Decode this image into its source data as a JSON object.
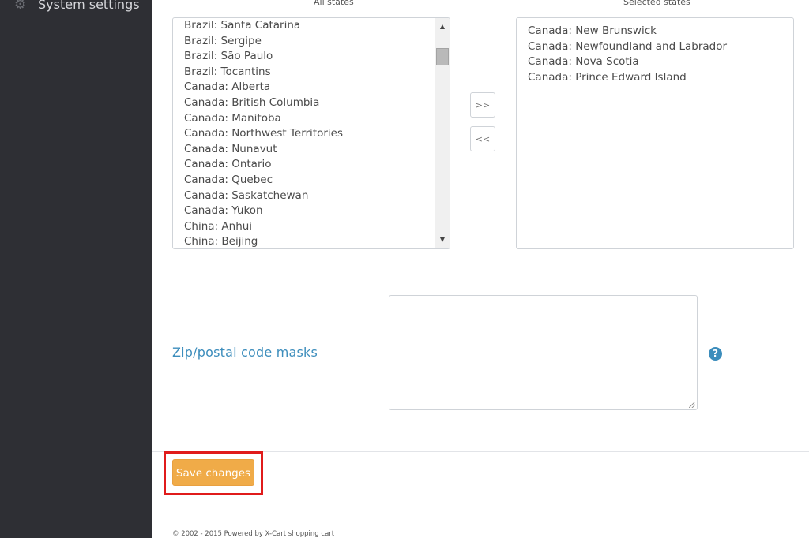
{
  "sidebar": {
    "items": [
      {
        "label": "System settings",
        "icon": "gear-icon"
      }
    ]
  },
  "states_selector": {
    "all_caption": "All states",
    "selected_caption": "Selected states",
    "all_states": [
      "Brazil: Santa Catarina",
      "Brazil: Sergipe",
      "Brazil: São Paulo",
      "Brazil: Tocantins",
      "Canada: Alberta",
      "Canada: British Columbia",
      "Canada: Manitoba",
      "Canada: Northwest Territories",
      "Canada: Nunavut",
      "Canada: Ontario",
      "Canada: Quebec",
      "Canada: Saskatchewan",
      "Canada: Yukon",
      "China: Anhui",
      "China: Beijing"
    ],
    "selected_states": [
      "Canada: New Brunswick",
      "Canada: Newfoundland and Labrador",
      "Canada: Nova Scotia",
      "Canada: Prince Edward Island"
    ],
    "add_label": ">>",
    "remove_label": "<<"
  },
  "zip": {
    "label": "Zip/postal code masks",
    "value": "",
    "help_label": "?"
  },
  "actions": {
    "save_label": "Save changes"
  },
  "footer": {
    "text": "© 2002 - 2015 Powered by X-Cart shopping cart"
  },
  "colors": {
    "sidebar_bg": "#2e2f34",
    "accent": "#3c8dbc",
    "save_button": "#f0ab48",
    "highlight": "#e01b1b"
  }
}
